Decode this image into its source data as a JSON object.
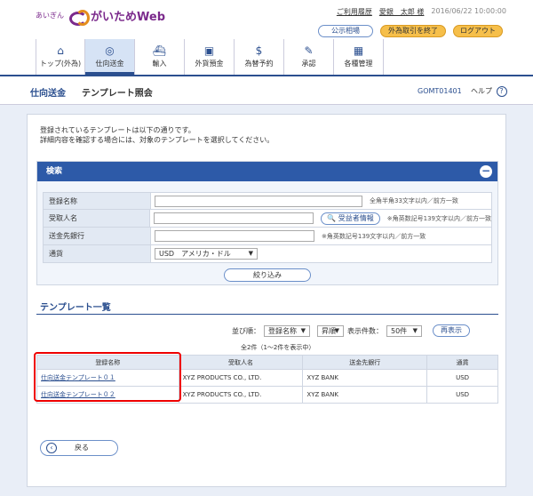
{
  "header": {
    "logo_small": "あいぎん",
    "logo_text": "がいためWeb",
    "links": {
      "history": "ご利用履歴",
      "user": "愛銀　太郎 様",
      "timestamp": "2016/06/22 10:00:00"
    },
    "buttons": {
      "market": "公示相場",
      "end_fx": "外為取引を終了",
      "logout": "ログアウト"
    }
  },
  "nav": {
    "items": [
      {
        "label": "トップ(外為)",
        "icon": "home-icon"
      },
      {
        "label": "仕向送金",
        "icon": "remit-icon"
      },
      {
        "label": "輸入",
        "icon": "ship-icon"
      },
      {
        "label": "外貨預金",
        "icon": "deposit-icon"
      },
      {
        "label": "為替予約",
        "icon": "forex-icon"
      },
      {
        "label": "承認",
        "icon": "approve-icon"
      },
      {
        "label": "各種管理",
        "icon": "manage-icon"
      }
    ]
  },
  "titlebar": {
    "crumb": "仕向送金",
    "title": "テンプレート照会",
    "code": "GOMT01401",
    "help": "ヘルプ"
  },
  "intro": {
    "line1": "登録されているテンプレートは以下の通りです。",
    "line2": "詳細内容を確認する場合には、対象のテンプレートを選択してください。"
  },
  "search": {
    "title": "検索",
    "rows": {
      "reg_name": {
        "label": "登録名称",
        "hint": "全角半角33文字以内／前方一致"
      },
      "recipient": {
        "label": "受取人名",
        "button": "受益者情報",
        "hint": "※角英数記号139文字以内／前方一致"
      },
      "bank": {
        "label": "送金先銀行",
        "hint": "※角英数記号139文字以内／前方一致"
      },
      "currency": {
        "label": "通貨",
        "value": "USD　アメリカ・ドル"
      }
    },
    "submit": "絞り込み"
  },
  "list": {
    "title": "テンプレート一覧",
    "sort_label": "並び順：",
    "sort_field": "登録名称",
    "sort_order": "昇順",
    "count_label": "表示件数：",
    "count_value": "50件",
    "reshow": "再表示",
    "total": "全2件（1～2件を表示中）",
    "columns": [
      "登録名称",
      "受取人名",
      "送金先銀行",
      "通貨"
    ],
    "rows": [
      {
        "name": "仕向送金テンプレート０１",
        "recipient": "XYZ PRODUCTS CO., LTD.",
        "bank": "XYZ BANK",
        "currency": "USD"
      },
      {
        "name": "仕向送金テンプレート０２",
        "recipient": "XYZ PRODUCTS CO., LTD.",
        "bank": "XYZ BANK",
        "currency": "USD"
      }
    ]
  },
  "back": "戻る"
}
